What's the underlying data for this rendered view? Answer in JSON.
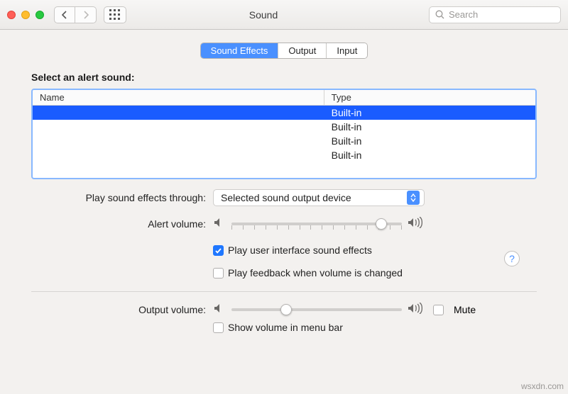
{
  "window": {
    "title": "Sound"
  },
  "search": {
    "placeholder": "Search"
  },
  "tabs": {
    "sound_effects": "Sound Effects",
    "output": "Output",
    "input": "Input"
  },
  "soundEffects": {
    "select_label": "Select an alert sound:",
    "columns": {
      "name": "Name",
      "type": "Type"
    },
    "rows": [
      {
        "name": "",
        "type": "Built-in",
        "selected": true
      },
      {
        "name": "",
        "type": "Built-in",
        "selected": false
      },
      {
        "name": "",
        "type": "Built-in",
        "selected": false
      },
      {
        "name": "",
        "type": "Built-in",
        "selected": false
      }
    ],
    "play_through_label": "Play sound effects through:",
    "play_through_value": "Selected sound output device",
    "alert_volume_label": "Alert volume:",
    "alert_volume_percent": 88,
    "play_ui_sounds_label": "Play user interface sound effects",
    "play_ui_sounds_checked": true,
    "play_feedback_label": "Play feedback when volume is changed",
    "play_feedback_checked": false
  },
  "output": {
    "volume_label": "Output volume:",
    "volume_percent": 32,
    "mute_label": "Mute",
    "mute_checked": false,
    "show_menu_bar_label": "Show volume in menu bar",
    "show_menu_bar_checked": false
  },
  "watermark": "wsxdn.com"
}
